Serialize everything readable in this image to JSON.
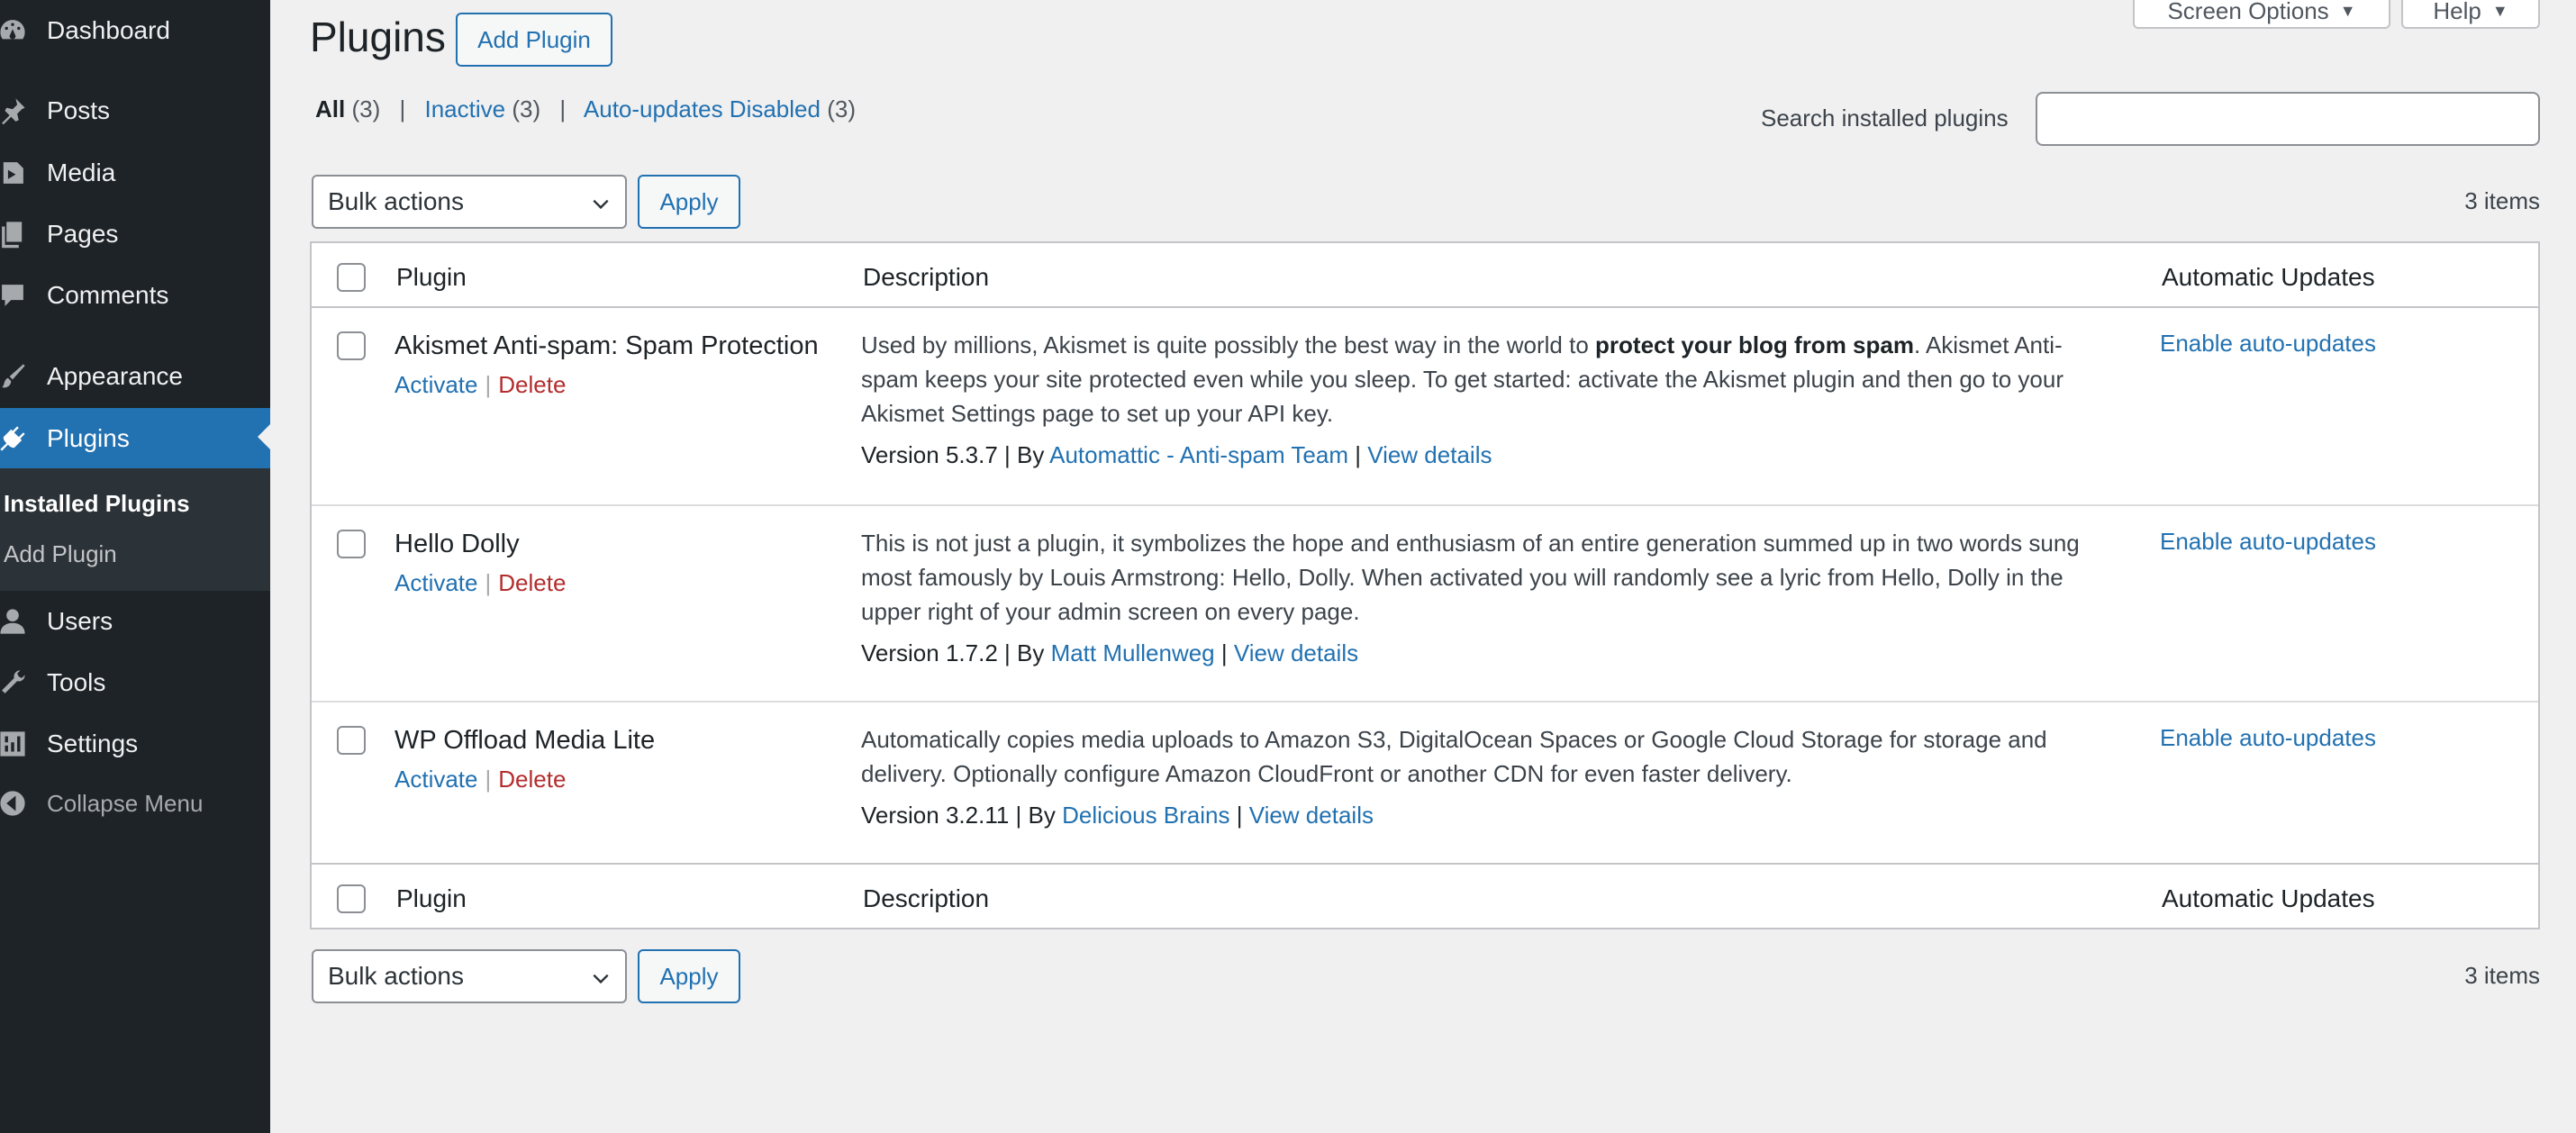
{
  "sidebar": {
    "items": [
      {
        "label": "Dashboard",
        "icon": "dashboard-icon"
      },
      {
        "label": "Posts",
        "icon": "pushpin-icon"
      },
      {
        "label": "Media",
        "icon": "media-icon"
      },
      {
        "label": "Pages",
        "icon": "pages-icon"
      },
      {
        "label": "Comments",
        "icon": "comment-icon"
      },
      {
        "label": "Appearance",
        "icon": "paintbrush-icon"
      },
      {
        "label": "Plugins",
        "icon": "plugin-icon"
      },
      {
        "label": "Users",
        "icon": "user-icon"
      },
      {
        "label": "Tools",
        "icon": "wrench-icon"
      },
      {
        "label": "Settings",
        "icon": "settings-icon"
      },
      {
        "label": "Collapse Menu",
        "icon": "collapse-icon"
      }
    ],
    "submenu": [
      {
        "label": "Installed Plugins"
      },
      {
        "label": "Add Plugin"
      }
    ]
  },
  "header": {
    "title": "Plugins",
    "add_button": "Add Plugin",
    "screen_options": "Screen Options",
    "help": "Help"
  },
  "filters": {
    "all_label": "All",
    "all_count": "(3)",
    "inactive_label": "Inactive",
    "inactive_count": "(3)",
    "auto_label": "Auto-updates Disabled",
    "auto_count": "(3)",
    "separator": "|"
  },
  "search": {
    "label": "Search installed plugins",
    "placeholder": ""
  },
  "bulk": {
    "selected": "Bulk actions",
    "apply": "Apply",
    "items": "3 items"
  },
  "table": {
    "columns": {
      "plugin": "Plugin",
      "description": "Description",
      "auto": "Automatic Updates"
    },
    "rows": [
      {
        "name": "Akismet Anti-spam: Spam Protection",
        "activate": "Activate",
        "delete": "Delete",
        "sep": "|",
        "desc_before": "Used by millions, Akismet is quite possibly the best way in the world to ",
        "desc_bold": "protect your blog from spam",
        "desc_after": ". Akismet Anti-spam keeps your site protected even while you sleep. To get started: activate the Akismet plugin and then go to your Akismet Settings page to set up your API key.",
        "version": "Version 5.3.7",
        "by": "By",
        "author": "Automattic - Anti-spam Team",
        "view": "View details",
        "auto": "Enable auto-updates"
      },
      {
        "name": "Hello Dolly",
        "activate": "Activate",
        "delete": "Delete",
        "sep": "|",
        "desc": "This is not just a plugin, it symbolizes the hope and enthusiasm of an entire generation summed up in two words sung most famously by Louis Armstrong: Hello, Dolly. When activated you will randomly see a lyric from Hello, Dolly in the upper right of your admin screen on every page.",
        "version": "Version 1.7.2",
        "by": "By",
        "author": "Matt Mullenweg",
        "view": "View details",
        "auto": "Enable auto-updates"
      },
      {
        "name": "WP Offload Media Lite",
        "activate": "Activate",
        "delete": "Delete",
        "sep": "|",
        "desc": "Automatically copies media uploads to Amazon S3, DigitalOcean Spaces or Google Cloud Storage for storage and delivery. Optionally configure Amazon CloudFront or another CDN for even faster delivery.",
        "version": "Version 3.2.11",
        "by": "By",
        "author": "Delicious Brains",
        "view": "View details",
        "auto": "Enable auto-updates"
      }
    ]
  },
  "colors": {
    "sidebar_bg": "#1d2327",
    "accent": "#2271b1",
    "delete": "#b32d2e",
    "page_bg": "#f0f0f1"
  }
}
